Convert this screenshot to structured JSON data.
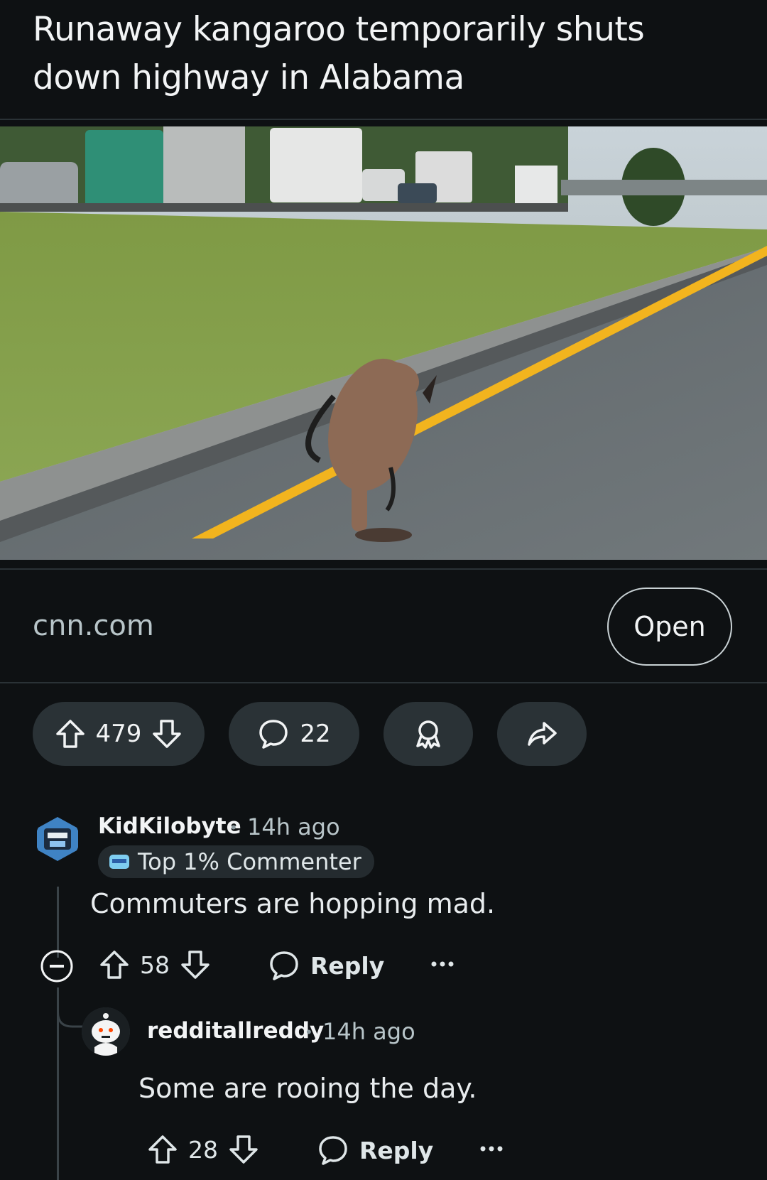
{
  "post": {
    "title": "Runaway kangaroo temporarily shuts down highway in Alabama",
    "link_domain": "cnn.com",
    "open_label": "Open",
    "votes": "479",
    "comments": "22"
  },
  "icons": {
    "upvote": "arrow-up-icon",
    "downvote": "arrow-down-icon",
    "comment": "speech-bubble-icon",
    "award": "award-icon",
    "share": "share-icon",
    "collapse": "minus-circle-icon",
    "more": "ellipsis-icon"
  },
  "comments": [
    {
      "user": "KidKilobyte",
      "age": "14h ago",
      "flair": "Top 1% Commenter",
      "text": "Commuters are hopping mad.",
      "votes": "58",
      "reply_label": "Reply"
    },
    {
      "user": "redditallreddy",
      "age": "14h ago",
      "text": "Some are rooing the day.",
      "votes": "28",
      "reply_label": "Reply"
    }
  ],
  "colors": {
    "background": "#0e1113",
    "pill": "#2a3236",
    "road_line": "#f2b41e",
    "muted_text": "#b8c5c9"
  }
}
